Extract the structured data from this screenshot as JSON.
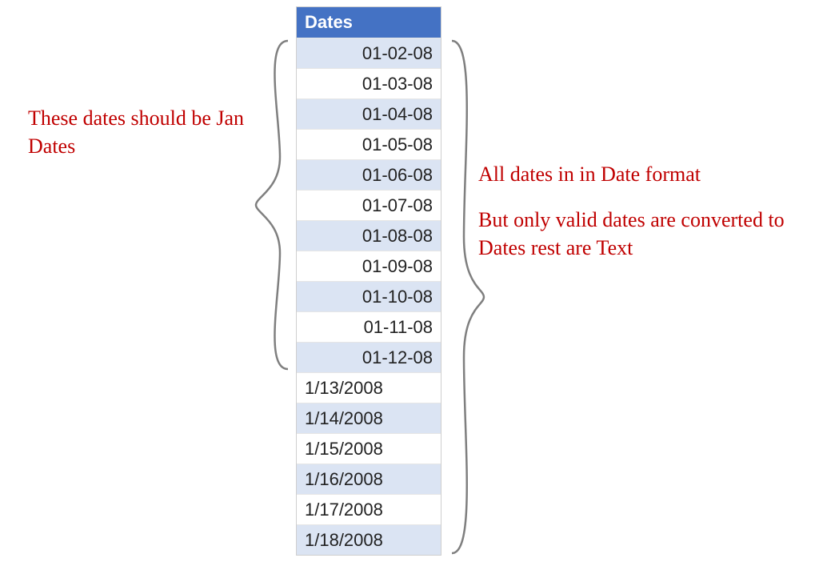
{
  "table": {
    "header": "Dates",
    "rows": [
      {
        "value": "01-02-08",
        "align": "right",
        "band": "a"
      },
      {
        "value": "01-03-08",
        "align": "right",
        "band": "b"
      },
      {
        "value": "01-04-08",
        "align": "right",
        "band": "a"
      },
      {
        "value": "01-05-08",
        "align": "right",
        "band": "b"
      },
      {
        "value": "01-06-08",
        "align": "right",
        "band": "a"
      },
      {
        "value": "01-07-08",
        "align": "right",
        "band": "b"
      },
      {
        "value": "01-08-08",
        "align": "right",
        "band": "a"
      },
      {
        "value": "01-09-08",
        "align": "right",
        "band": "b"
      },
      {
        "value": "01-10-08",
        "align": "right",
        "band": "a"
      },
      {
        "value": "01-11-08",
        "align": "right",
        "band": "b"
      },
      {
        "value": "01-12-08",
        "align": "right",
        "band": "a"
      },
      {
        "value": "1/13/2008",
        "align": "left",
        "band": "b"
      },
      {
        "value": "1/14/2008",
        "align": "left",
        "band": "a"
      },
      {
        "value": "1/15/2008",
        "align": "left",
        "band": "b"
      },
      {
        "value": "1/16/2008",
        "align": "left",
        "band": "a"
      },
      {
        "value": "1/17/2008",
        "align": "left",
        "band": "b"
      },
      {
        "value": "1/18/2008",
        "align": "left",
        "band": "a"
      }
    ]
  },
  "annotations": {
    "left": "These dates should be Jan Dates",
    "right_p1": "All dates in in Date format",
    "right_p2": "But only valid dates are converted to Dates rest are Text"
  },
  "colors": {
    "header_bg": "#4472C4",
    "band_a": "#dbe4f3",
    "band_b": "#ffffff",
    "annotation_red": "#c00000",
    "brace_gray": "#7f7f7f"
  }
}
